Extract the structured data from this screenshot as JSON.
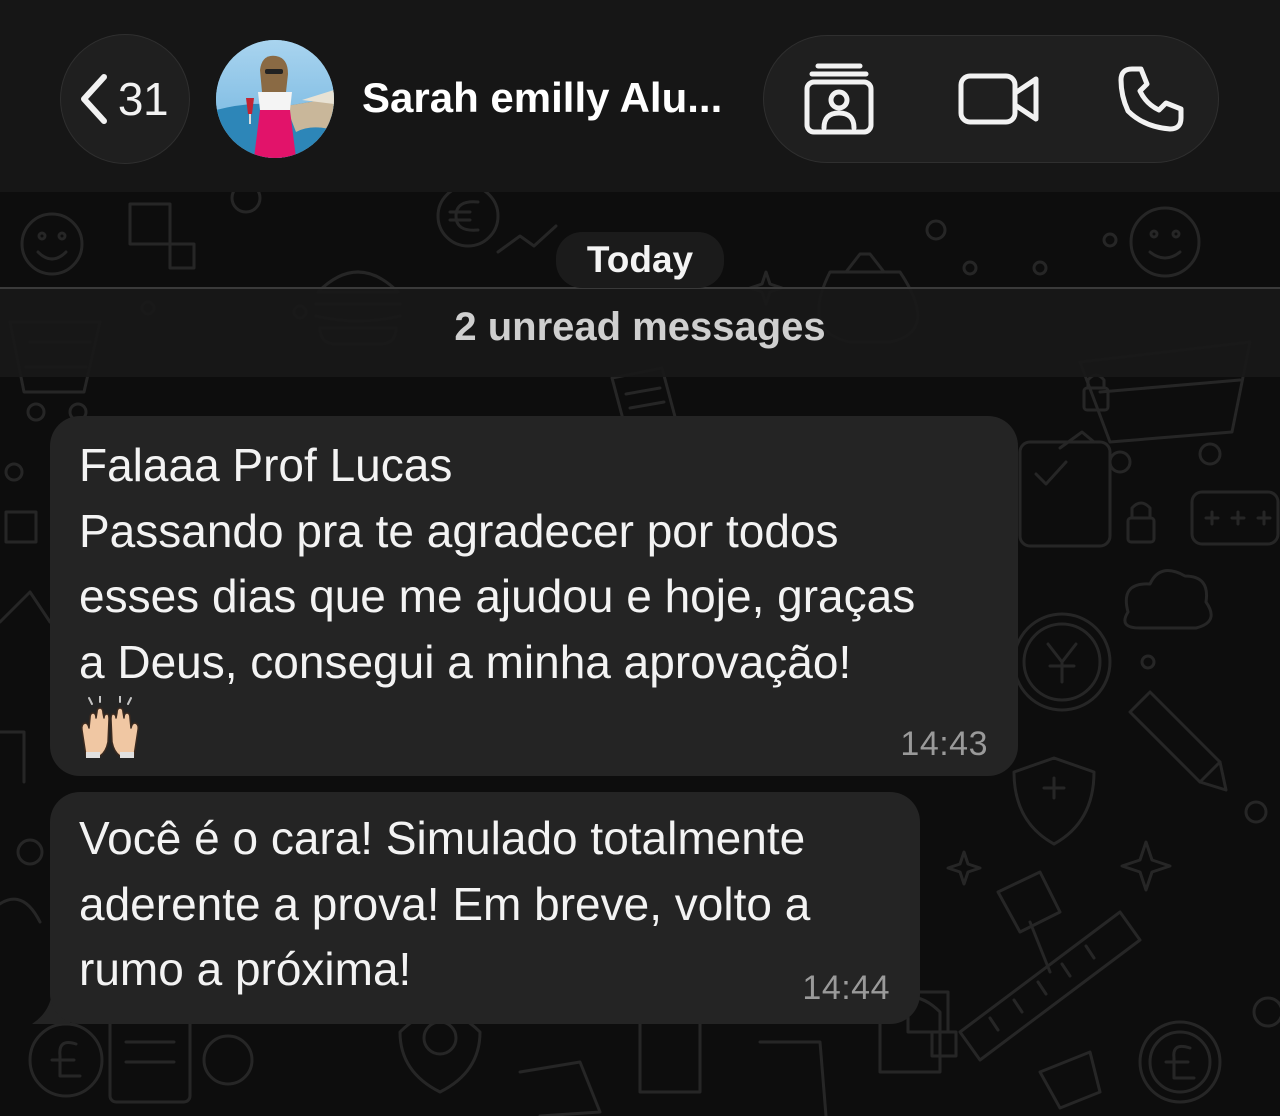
{
  "header": {
    "back_count": "31",
    "contact_name": "Sarah emilly Alu...",
    "icons": {
      "back": "chevron-left-icon",
      "contact_card": "contact-card-icon",
      "video": "video-camera-icon",
      "phone": "phone-icon"
    }
  },
  "chat": {
    "date_label": "Today",
    "unread_label": "2 unread messages",
    "messages": [
      {
        "text": "Falaaa Prof Lucas\nPassando pra te agradecer por todos\nesses dias que me ajudou e hoje, graças\na Deus, consegui a minha aprovação!",
        "emoji": "🙌🏼",
        "time": "14:43"
      },
      {
        "text": "Você é o cara! Simulado totalmente\naderente a prova! Em breve, volto a\nrumo a próxima!",
        "time": "14:44"
      }
    ]
  },
  "colors": {
    "header_bg": "#161616",
    "chat_bg": "#0d0d0d",
    "bubble_bg": "#242424",
    "text": "#f3f3f3",
    "timestamp": "#9a9a9a"
  }
}
